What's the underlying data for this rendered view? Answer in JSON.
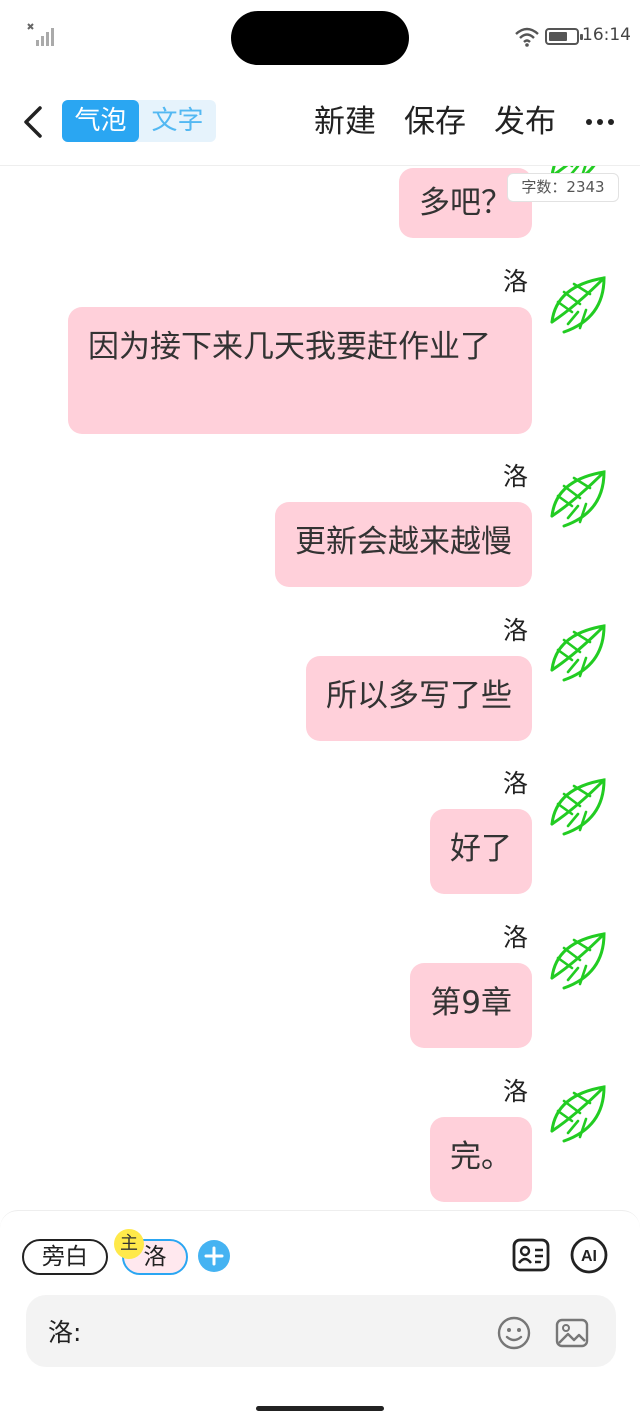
{
  "status_bar": {
    "time": "16:14",
    "battery_percent": 70
  },
  "header": {
    "mode_tabs": [
      {
        "label": "气泡",
        "active": true
      },
      {
        "label": "文字",
        "active": false
      }
    ],
    "actions": {
      "new": "新建",
      "save": "保存",
      "publish": "发布"
    },
    "more_icon": "more-dots-icon"
  },
  "word_count": "字数：2343",
  "messages": [
    {
      "speaker": "",
      "text": "多吧？"
    },
    {
      "speaker": "洛",
      "text": "因为接下来几天我要赶作业了"
    },
    {
      "speaker": "洛",
      "text": "更新会越来越慢"
    },
    {
      "speaker": "洛",
      "text": "所以多写了些"
    },
    {
      "speaker": "洛",
      "text": "好了"
    },
    {
      "speaker": "洛",
      "text": "第9章"
    },
    {
      "speaker": "洛",
      "text": "完。"
    }
  ],
  "composer": {
    "narration_chip": "旁白",
    "role_chip": "洛",
    "role_badge": "主",
    "input_prefix": "洛:",
    "icons": [
      "plus-icon",
      "character-card-icon",
      "ai-icon",
      "emoji-icon",
      "image-icon"
    ]
  },
  "colors": {
    "accent": "#2aa6f2",
    "bubble": "#ffd0da",
    "avatar_leaf": "#22cc22"
  }
}
